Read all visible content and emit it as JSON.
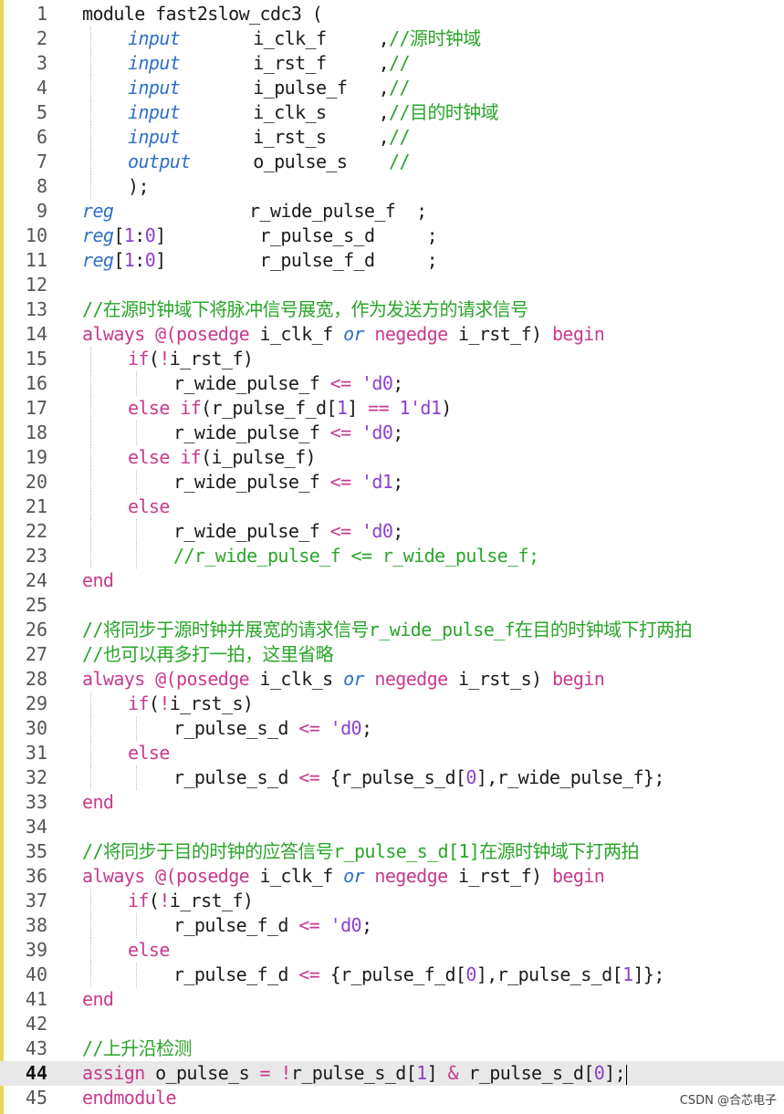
{
  "editor": {
    "current_line": 44,
    "colors": {
      "keyword": "#c83a8c",
      "type": "#2e6fc7",
      "comment": "#2aa52a",
      "number": "#8a3fd1",
      "default": "#1b1b1b",
      "current_line_bg": "#e8e8e8"
    },
    "lines": [
      {
        "n": "1",
        "indent": 0,
        "parts": [
          {
            "t": "module fast2slow_cdc3 (",
            "c": "k0"
          }
        ]
      },
      {
        "n": "2",
        "indent": 1,
        "parts": [
          {
            "t": "input",
            "c": "ty"
          },
          {
            "t": "       i_clk_f     ,"
          },
          {
            "t": "//源时钟域",
            "c": "cm"
          }
        ]
      },
      {
        "n": "3",
        "indent": 1,
        "parts": [
          {
            "t": "input",
            "c": "ty"
          },
          {
            "t": "       i_rst_f     ,"
          },
          {
            "t": "//",
            "c": "cm"
          }
        ]
      },
      {
        "n": "4",
        "indent": 1,
        "parts": [
          {
            "t": "input",
            "c": "ty"
          },
          {
            "t": "       i_pulse_f   ,"
          },
          {
            "t": "//",
            "c": "cm"
          }
        ]
      },
      {
        "n": "5",
        "indent": 1,
        "parts": [
          {
            "t": "input",
            "c": "ty"
          },
          {
            "t": "       i_clk_s     ,"
          },
          {
            "t": "//目的时钟域",
            "c": "cm"
          }
        ]
      },
      {
        "n": "6",
        "indent": 1,
        "parts": [
          {
            "t": "input",
            "c": "ty"
          },
          {
            "t": "       i_rst_s     ,"
          },
          {
            "t": "//",
            "c": "cm"
          }
        ]
      },
      {
        "n": "7",
        "indent": 1,
        "parts": [
          {
            "t": "output",
            "c": "ty"
          },
          {
            "t": "      o_pulse_s    "
          },
          {
            "t": "//",
            "c": "cm"
          }
        ]
      },
      {
        "n": "8",
        "indent": 1,
        "parts": [
          {
            "t": ");"
          }
        ]
      },
      {
        "n": "9",
        "indent": 0,
        "parts": [
          {
            "t": "reg",
            "c": "ty"
          },
          {
            "t": "             r_wide_pulse_f  ;"
          }
        ]
      },
      {
        "n": "10",
        "indent": 0,
        "parts": [
          {
            "t": "reg",
            "c": "ty"
          },
          {
            "t": "["
          },
          {
            "t": "1",
            "c": "nm"
          },
          {
            "t": ":"
          },
          {
            "t": "0",
            "c": "nm"
          },
          {
            "t": "]         r_pulse_s_d     ;"
          }
        ]
      },
      {
        "n": "11",
        "indent": 0,
        "parts": [
          {
            "t": "reg",
            "c": "ty"
          },
          {
            "t": "["
          },
          {
            "t": "1",
            "c": "nm"
          },
          {
            "t": ":"
          },
          {
            "t": "0",
            "c": "nm"
          },
          {
            "t": "]         r_pulse_f_d     ;"
          }
        ]
      },
      {
        "n": "12",
        "indent": 0,
        "parts": []
      },
      {
        "n": "13",
        "indent": 0,
        "parts": [
          {
            "t": "//在源时钟域下将脉冲信号展宽，作为发送方的请求信号",
            "c": "cm"
          }
        ]
      },
      {
        "n": "14",
        "indent": 0,
        "parts": [
          {
            "t": "always",
            "c": "kw"
          },
          {
            "t": " "
          },
          {
            "t": "@(",
            "c": "op"
          },
          {
            "t": "posedge",
            "c": "kw"
          },
          {
            "t": " i_clk_f "
          },
          {
            "t": "or",
            "c": "ty"
          },
          {
            "t": " "
          },
          {
            "t": "negedge",
            "c": "kw"
          },
          {
            "t": " i_rst_f) "
          },
          {
            "t": "begin",
            "c": "kw"
          }
        ]
      },
      {
        "n": "15",
        "indent": 1,
        "parts": [
          {
            "t": "if",
            "c": "kw"
          },
          {
            "t": "("
          },
          {
            "t": "!",
            "c": "op"
          },
          {
            "t": "i_rst_f)"
          }
        ]
      },
      {
        "n": "16",
        "indent": 2,
        "parts": [
          {
            "t": "r_wide_pulse_f "
          },
          {
            "t": "<=",
            "c": "op"
          },
          {
            "t": " "
          },
          {
            "t": "'d0",
            "c": "nm"
          },
          {
            "t": ";"
          }
        ]
      },
      {
        "n": "17",
        "indent": 1,
        "parts": [
          {
            "t": "else if",
            "c": "kw"
          },
          {
            "t": "(r_pulse_f_d["
          },
          {
            "t": "1",
            "c": "nm"
          },
          {
            "t": "] "
          },
          {
            "t": "==",
            "c": "op"
          },
          {
            "t": " "
          },
          {
            "t": "1'd1",
            "c": "nm"
          },
          {
            "t": ")"
          }
        ]
      },
      {
        "n": "18",
        "indent": 2,
        "parts": [
          {
            "t": "r_wide_pulse_f "
          },
          {
            "t": "<=",
            "c": "op"
          },
          {
            "t": " "
          },
          {
            "t": "'d0",
            "c": "nm"
          },
          {
            "t": ";"
          }
        ]
      },
      {
        "n": "19",
        "indent": 1,
        "parts": [
          {
            "t": "else if",
            "c": "kw"
          },
          {
            "t": "(i_pulse_f)"
          }
        ]
      },
      {
        "n": "20",
        "indent": 2,
        "parts": [
          {
            "t": "r_wide_pulse_f "
          },
          {
            "t": "<=",
            "c": "op"
          },
          {
            "t": " "
          },
          {
            "t": "'d1",
            "c": "nm"
          },
          {
            "t": ";"
          }
        ]
      },
      {
        "n": "21",
        "indent": 1,
        "parts": [
          {
            "t": "else",
            "c": "kw"
          }
        ]
      },
      {
        "n": "22",
        "indent": 2,
        "parts": [
          {
            "t": "r_wide_pulse_f "
          },
          {
            "t": "<=",
            "c": "op"
          },
          {
            "t": " "
          },
          {
            "t": "'d0",
            "c": "nm"
          },
          {
            "t": ";"
          }
        ]
      },
      {
        "n": "23",
        "indent": 2,
        "parts": [
          {
            "t": "//r_wide_pulse_f <= r_wide_pulse_f;",
            "c": "cm"
          }
        ]
      },
      {
        "n": "24",
        "indent": 0,
        "parts": [
          {
            "t": "end",
            "c": "kw"
          }
        ]
      },
      {
        "n": "25",
        "indent": 0,
        "parts": []
      },
      {
        "n": "26",
        "indent": 0,
        "parts": [
          {
            "t": "//将同步于源时钟并展宽的请求信号r_wide_pulse_f在目的时钟域下打两拍",
            "c": "cm"
          }
        ]
      },
      {
        "n": "27",
        "indent": 0,
        "parts": [
          {
            "t": "//也可以再多打一拍，这里省略",
            "c": "cm"
          }
        ]
      },
      {
        "n": "28",
        "indent": 0,
        "parts": [
          {
            "t": "always",
            "c": "kw"
          },
          {
            "t": " "
          },
          {
            "t": "@(",
            "c": "op"
          },
          {
            "t": "posedge",
            "c": "kw"
          },
          {
            "t": " i_clk_s "
          },
          {
            "t": "or",
            "c": "ty"
          },
          {
            "t": " "
          },
          {
            "t": "negedge",
            "c": "kw"
          },
          {
            "t": " i_rst_s) "
          },
          {
            "t": "begin",
            "c": "kw"
          }
        ]
      },
      {
        "n": "29",
        "indent": 1,
        "parts": [
          {
            "t": "if",
            "c": "kw"
          },
          {
            "t": "("
          },
          {
            "t": "!",
            "c": "op"
          },
          {
            "t": "i_rst_s)"
          }
        ]
      },
      {
        "n": "30",
        "indent": 2,
        "parts": [
          {
            "t": "r_pulse_s_d "
          },
          {
            "t": "<=",
            "c": "op"
          },
          {
            "t": " "
          },
          {
            "t": "'d0",
            "c": "nm"
          },
          {
            "t": ";"
          }
        ]
      },
      {
        "n": "31",
        "indent": 1,
        "parts": [
          {
            "t": "else",
            "c": "kw"
          }
        ]
      },
      {
        "n": "32",
        "indent": 2,
        "parts": [
          {
            "t": "r_pulse_s_d "
          },
          {
            "t": "<=",
            "c": "op"
          },
          {
            "t": " {r_pulse_s_d["
          },
          {
            "t": "0",
            "c": "nm"
          },
          {
            "t": "],r_wide_pulse_f};"
          }
        ]
      },
      {
        "n": "33",
        "indent": 0,
        "parts": [
          {
            "t": "end",
            "c": "kw"
          }
        ]
      },
      {
        "n": "34",
        "indent": 0,
        "parts": []
      },
      {
        "n": "35",
        "indent": 0,
        "parts": [
          {
            "t": "//将同步于目的时钟的应答信号r_pulse_s_d[1]在源时钟域下打两拍",
            "c": "cm"
          }
        ]
      },
      {
        "n": "36",
        "indent": 0,
        "parts": [
          {
            "t": "always",
            "c": "kw"
          },
          {
            "t": " "
          },
          {
            "t": "@(",
            "c": "op"
          },
          {
            "t": "posedge",
            "c": "kw"
          },
          {
            "t": " i_clk_f "
          },
          {
            "t": "or",
            "c": "ty"
          },
          {
            "t": " "
          },
          {
            "t": "negedge",
            "c": "kw"
          },
          {
            "t": " i_rst_f) "
          },
          {
            "t": "begin",
            "c": "kw"
          }
        ]
      },
      {
        "n": "37",
        "indent": 1,
        "parts": [
          {
            "t": "if",
            "c": "kw"
          },
          {
            "t": "("
          },
          {
            "t": "!",
            "c": "op"
          },
          {
            "t": "i_rst_f)"
          }
        ]
      },
      {
        "n": "38",
        "indent": 2,
        "parts": [
          {
            "t": "r_pulse_f_d "
          },
          {
            "t": "<=",
            "c": "op"
          },
          {
            "t": " "
          },
          {
            "t": "'d0",
            "c": "nm"
          },
          {
            "t": ";"
          }
        ]
      },
      {
        "n": "39",
        "indent": 1,
        "parts": [
          {
            "t": "else",
            "c": "kw"
          }
        ]
      },
      {
        "n": "40",
        "indent": 2,
        "parts": [
          {
            "t": "r_pulse_f_d "
          },
          {
            "t": "<=",
            "c": "op"
          },
          {
            "t": " {r_pulse_f_d["
          },
          {
            "t": "0",
            "c": "nm"
          },
          {
            "t": "],r_pulse_s_d["
          },
          {
            "t": "1",
            "c": "nm"
          },
          {
            "t": "]};"
          }
        ]
      },
      {
        "n": "41",
        "indent": 0,
        "parts": [
          {
            "t": "end",
            "c": "kw"
          }
        ]
      },
      {
        "n": "42",
        "indent": 0,
        "parts": []
      },
      {
        "n": "43",
        "indent": 0,
        "parts": [
          {
            "t": "//上升沿检测",
            "c": "cm"
          }
        ]
      },
      {
        "n": "44",
        "indent": 0,
        "parts": [
          {
            "t": "assign",
            "c": "kw"
          },
          {
            "t": " o_pulse_s "
          },
          {
            "t": "=",
            "c": "op"
          },
          {
            "t": " "
          },
          {
            "t": "!",
            "c": "op"
          },
          {
            "t": "r_pulse_s_d["
          },
          {
            "t": "1",
            "c": "nm"
          },
          {
            "t": "] "
          },
          {
            "t": "&",
            "c": "op"
          },
          {
            "t": " r_pulse_s_d["
          },
          {
            "t": "0",
            "c": "nm"
          },
          {
            "t": "];"
          }
        ]
      },
      {
        "n": "45",
        "indent": 0,
        "parts": [
          {
            "t": "endmodule",
            "c": "kw"
          }
        ]
      }
    ]
  },
  "watermark": "CSDN @合芯电子"
}
